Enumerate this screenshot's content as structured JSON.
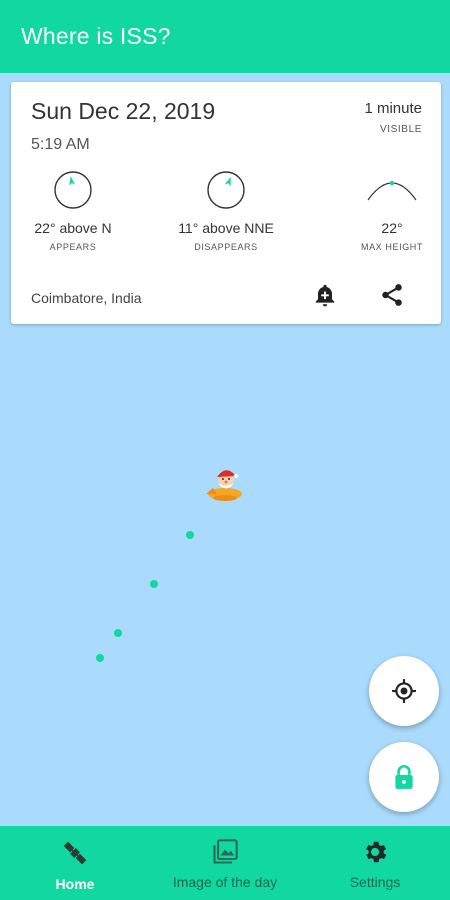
{
  "appbar": {
    "title": "Where is ISS?"
  },
  "pass": {
    "date": "Sun Dec 22, 2019",
    "time": "5:19 AM",
    "duration": "1 minute",
    "duration_caption": "VISIBLE",
    "appears": {
      "value": "22° above N",
      "caption": "APPEARS"
    },
    "disappears": {
      "value": "11° above NNE",
      "caption": "DISAPPEARS"
    },
    "max_height": {
      "value": "22°",
      "caption": "MAX HEIGHT"
    },
    "location": "Coimbatore, India"
  },
  "colors": {
    "accent": "#10d8a0",
    "map": "#aadbfd"
  },
  "icons": {
    "reminder": "add-alarm-icon",
    "share": "share-icon",
    "my_location": "crosshair-icon",
    "lock": "lock-icon",
    "iss_marker": "santa-plane-icon"
  },
  "bottom_nav": {
    "home": "Home",
    "image_of_day": "Image of the day",
    "settings": "Settings"
  }
}
